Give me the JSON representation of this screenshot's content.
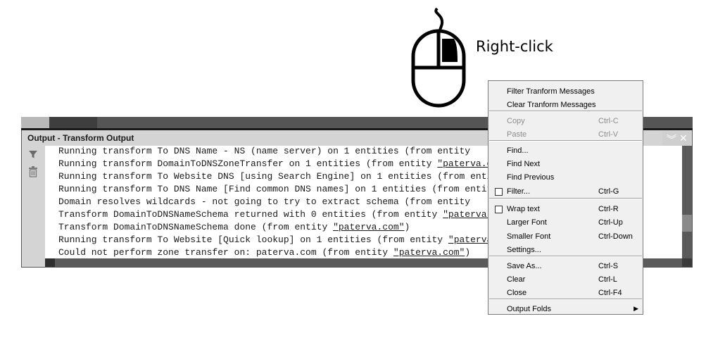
{
  "annotation": {
    "label": "Right-click"
  },
  "window": {
    "title": "Output - Transform Output",
    "lines": [
      [
        {
          "t": "Running transform To DNS Name - NS (name server) on 1 entities (from entity "
        }
      ],
      [
        {
          "t": "Running transform DomainToDNSZoneTransfer on 1 entities (from entity "
        },
        {
          "t": "\"paterva.com\"",
          "link": true
        },
        {
          "t": ")"
        }
      ],
      [
        {
          "t": "Running transform To Website DNS [using Search Engine] on 1 entities (from entity "
        }
      ],
      [
        {
          "t": "Running transform To DNS Name [Find common DNS names] on 1 entities (from entity "
        }
      ],
      [
        {
          "t": "Domain resolves wildcards - not going to try to extract schema (from entity "
        }
      ],
      [
        {
          "t": "Transform DomainToDNSNameSchema returned with 0 entities (from entity "
        },
        {
          "t": "\"paterva.com\"",
          "link": true
        },
        {
          "t": ")"
        }
      ],
      [
        {
          "t": "Transform DomainToDNSNameSchema done (from entity "
        },
        {
          "t": "\"paterva.com\"",
          "link": true
        },
        {
          "t": ")"
        }
      ],
      [
        {
          "t": "Running transform To Website [Quick lookup] on 1 entities (from entity "
        },
        {
          "t": "\"paterva.com\"",
          "link": true
        },
        {
          "t": ")"
        }
      ],
      [
        {
          "t": "Could not perform zone transfer on: paterva.com (from entity "
        },
        {
          "t": "\"paterva.com\"",
          "link": true
        },
        {
          "t": ")"
        }
      ]
    ],
    "icons": {
      "filter": "filter-icon",
      "clear": "trash-icon",
      "collapse": "chevron-double-down-icon",
      "close": "close-icon"
    }
  },
  "context_menu": {
    "items": [
      {
        "label": "Filter Tranform Messages",
        "shortcut": "",
        "disabled": false,
        "checkbox": false,
        "submenu": false
      },
      {
        "label": "Clear Tranform Messages",
        "shortcut": "",
        "disabled": false,
        "checkbox": false,
        "submenu": false
      },
      {
        "label": "Copy",
        "shortcut": "Ctrl-C",
        "disabled": true,
        "checkbox": false,
        "submenu": false
      },
      {
        "label": "Paste",
        "shortcut": "Ctrl-V",
        "disabled": true,
        "checkbox": false,
        "submenu": false
      },
      {
        "label": "Find...",
        "shortcut": "",
        "disabled": false,
        "checkbox": false,
        "submenu": false
      },
      {
        "label": "Find Next",
        "shortcut": "",
        "disabled": false,
        "checkbox": false,
        "submenu": false
      },
      {
        "label": "Find Previous",
        "shortcut": "",
        "disabled": false,
        "checkbox": false,
        "submenu": false
      },
      {
        "label": "Filter...",
        "shortcut": "Ctrl-G",
        "disabled": false,
        "checkbox": true,
        "submenu": false
      },
      {
        "label": "Wrap text",
        "shortcut": "Ctrl-R",
        "disabled": false,
        "checkbox": true,
        "submenu": false
      },
      {
        "label": "Larger Font",
        "shortcut": "Ctrl-Up",
        "disabled": false,
        "checkbox": false,
        "submenu": false
      },
      {
        "label": "Smaller Font",
        "shortcut": "Ctrl-Down",
        "disabled": false,
        "checkbox": false,
        "submenu": false
      },
      {
        "label": "Settings...",
        "shortcut": "",
        "disabled": false,
        "checkbox": false,
        "submenu": false
      },
      {
        "label": "Save As...",
        "shortcut": "Ctrl-S",
        "disabled": false,
        "checkbox": false,
        "submenu": false
      },
      {
        "label": "Clear",
        "shortcut": "Ctrl-L",
        "disabled": false,
        "checkbox": false,
        "submenu": false
      },
      {
        "label": "Close",
        "shortcut": "Ctrl-F4",
        "disabled": false,
        "checkbox": false,
        "submenu": false
      },
      {
        "label": "Output Folds",
        "shortcut": "",
        "disabled": false,
        "checkbox": false,
        "submenu": true
      }
    ]
  },
  "colors": {
    "menu_bg": "#f0f0f0",
    "scrollbar": "#5a5a5a",
    "panel": "#d4d4d4"
  }
}
